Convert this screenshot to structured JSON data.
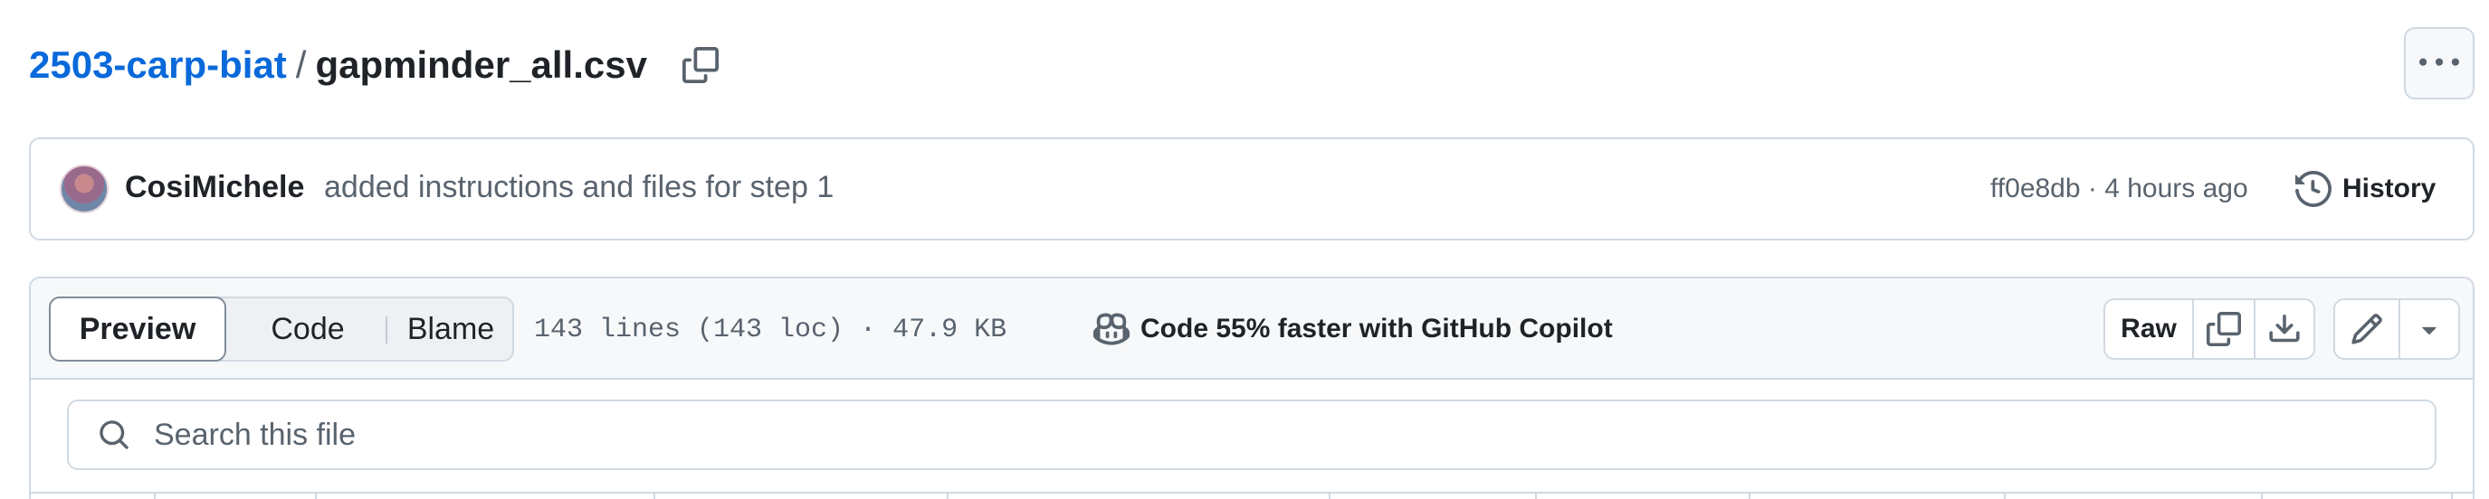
{
  "breadcrumb": {
    "repo": "2503-carp-biat",
    "separator": "/",
    "file": "gapminder_all.csv",
    "copy_icon": "copy-icon"
  },
  "header_actions": {
    "more_icon": "kebab-horizontal-icon"
  },
  "commit": {
    "author": "CosiMichele",
    "message": "added instructions and files for step 1",
    "meta": "ff0e8db · 4 hours ago",
    "history_label": "History",
    "history_icon": "history-icon"
  },
  "file_header": {
    "tabs": [
      {
        "label": "Preview",
        "selected": true
      },
      {
        "label": "Code",
        "selected": false
      },
      {
        "label": "Blame",
        "selected": false
      }
    ],
    "info": "143 lines (143 loc) · 47.9 KB",
    "copilot_label": "Code 55% faster with GitHub Copilot",
    "copilot_icon": "copilot-icon",
    "raw_label": "Raw",
    "copy_icon": "copy-icon",
    "download_icon": "download-icon",
    "edit_icon": "pencil-icon",
    "edit_menu_icon": "triangle-down-icon"
  },
  "search": {
    "placeholder": "Search this file",
    "value": ""
  },
  "colors": {
    "accent": "#0969da",
    "border": "#d1d9e0",
    "muted": "#59636e",
    "header_bg": "#f6f8fa"
  }
}
